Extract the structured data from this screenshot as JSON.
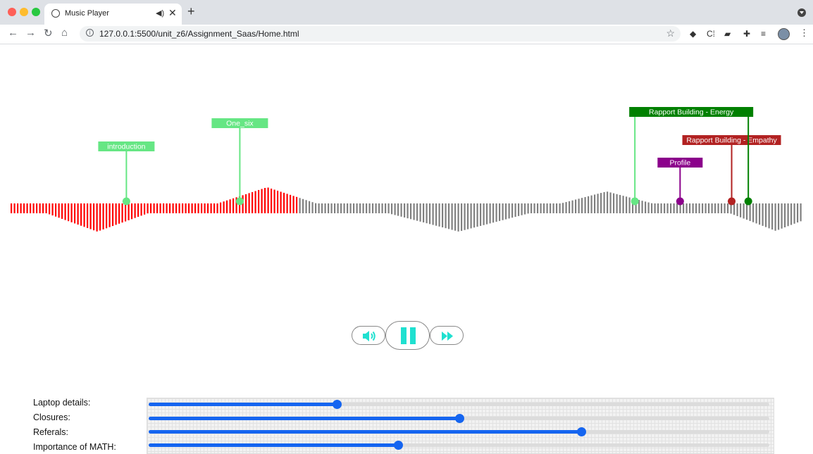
{
  "browser": {
    "tab_title": "Music Player",
    "tab_audio_icon": "speaker-icon",
    "tab_close": "✕",
    "new_tab": "+",
    "url": "127.0.0.1:5500/unit_z6/Assignment_Saas/Home.html",
    "star": "☆",
    "extensions": [
      "◆",
      "C⁞",
      "▰",
      "✚",
      "≡"
    ],
    "menu": "⋮"
  },
  "player": {
    "played_color": "#ff0000",
    "unplayed_color": "#808080",
    "progress_fraction": 0.36,
    "markers": [
      {
        "label": "introduction",
        "color": "#66e684",
        "position_fraction": 0.146
      },
      {
        "label": "One_six",
        "color": "#66e684",
        "position_fraction": 0.289
      },
      {
        "label": "Rapport Building - Energy",
        "color": "#66e684",
        "label_color": "#008000",
        "position_fraction": 0.787
      },
      {
        "label": "Profile",
        "color": "#8b008b",
        "position_fraction": 0.844
      },
      {
        "label": "Rapport Building - Empathy",
        "color": "#b22222",
        "position_fraction": 0.909
      },
      {
        "label": "",
        "color": "#008000",
        "position_fraction": 0.93
      }
    ],
    "controls": {
      "volume_icon": "volume-icon",
      "play_pause_icon": "pause-icon",
      "fast_forward_icon": "fast-forward-icon",
      "accent": "#1fe0d0"
    }
  },
  "sliders": [
    {
      "label": "Laptop details:",
      "value": 0.303
    },
    {
      "label": "Closures:",
      "value": 0.5
    },
    {
      "label": "Referals:",
      "value": 0.697
    },
    {
      "label": "Importance of MATH:",
      "value": 0.402
    }
  ]
}
